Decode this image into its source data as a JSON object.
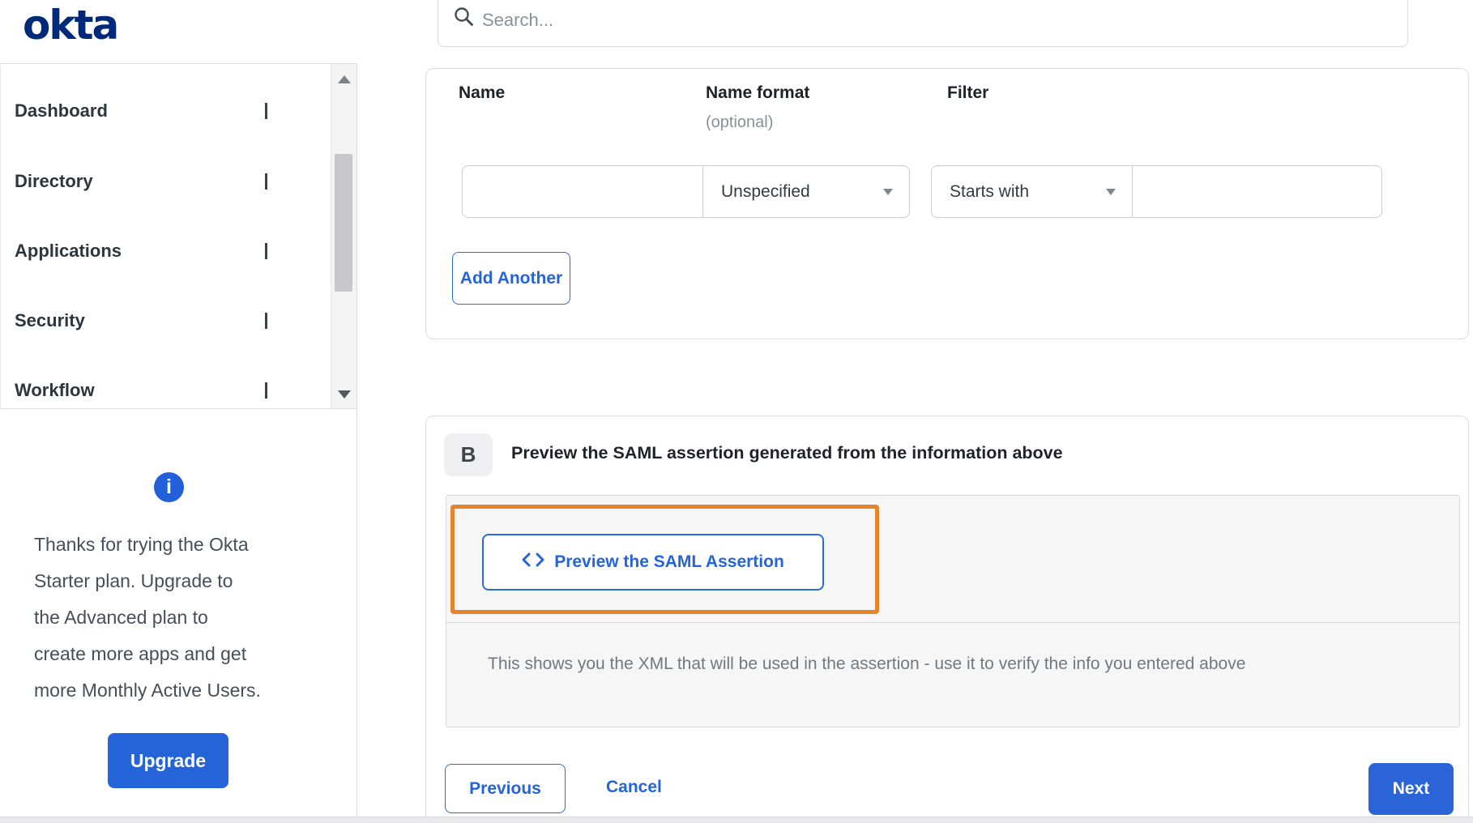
{
  "brand": {
    "logo_text": "okta"
  },
  "search": {
    "placeholder": "Search..."
  },
  "sidebar": {
    "items": [
      {
        "label": "Dashboard"
      },
      {
        "label": "Directory"
      },
      {
        "label": "Applications"
      },
      {
        "label": "Security"
      },
      {
        "label": "Workflow"
      }
    ],
    "upsell": {
      "text_lines": [
        "Thanks for trying the Okta",
        "Starter plan. Upgrade to",
        "the Advanced plan to",
        "create more apps and get",
        "more Monthly Active Users."
      ],
      "button_label": "Upgrade"
    }
  },
  "attribute_form": {
    "columns": [
      {
        "label": "Name",
        "sub": ""
      },
      {
        "label": "Name format",
        "sub": "(optional)"
      },
      {
        "label": "Filter",
        "sub": ""
      }
    ],
    "name_value": "",
    "name_format_value": "Unspecified",
    "filter_type_value": "Starts with",
    "filter_value": "",
    "add_another_label": "Add Another"
  },
  "preview_section": {
    "badge": "B",
    "title": "Preview the SAML assertion generated from the information above",
    "preview_button_label": "Preview the SAML Assertion",
    "note": "This shows you the XML that will be used in the assertion - use it to verify the info you entered above"
  },
  "footer": {
    "previous_label": "Previous",
    "cancel_label": "Cancel",
    "next_label": "Next"
  },
  "colors": {
    "accent_blue": "#2563d8",
    "logo_navy": "#00297a",
    "highlight_orange": "#e5852b",
    "panel_gray": "#f6f6f7"
  }
}
